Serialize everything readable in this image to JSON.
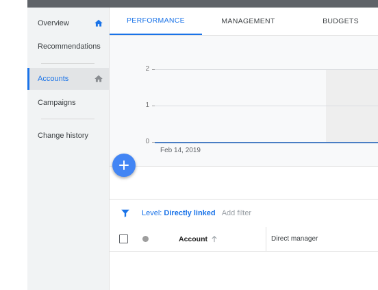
{
  "sidebar": {
    "items": [
      {
        "label": "Overview",
        "icon": "home-icon"
      },
      {
        "label": "Recommendations"
      },
      {
        "label": "Accounts",
        "icon": "home-icon"
      },
      {
        "label": "Campaigns"
      },
      {
        "label": "Change history"
      }
    ]
  },
  "tabs": [
    "PERFORMANCE",
    "MANAGEMENT",
    "BUDGETS"
  ],
  "chart_data": {
    "type": "line",
    "y_ticks": [
      "2",
      "1",
      "0"
    ],
    "ylim": [
      0,
      2
    ],
    "x": [
      "Feb 14, 2019"
    ],
    "series": [
      {
        "values": [
          0
        ]
      }
    ],
    "line_color": "#4a7ec4"
  },
  "filter": {
    "level_label": "Level:",
    "level_value": "Directly linked",
    "add_filter": "Add filter"
  },
  "table": {
    "headers": {
      "account": "Account",
      "direct_manager": "Direct manager"
    }
  },
  "colors": {
    "accent": "#1a73e8",
    "fab": "#4285f4",
    "topbar": "#5f6368"
  }
}
